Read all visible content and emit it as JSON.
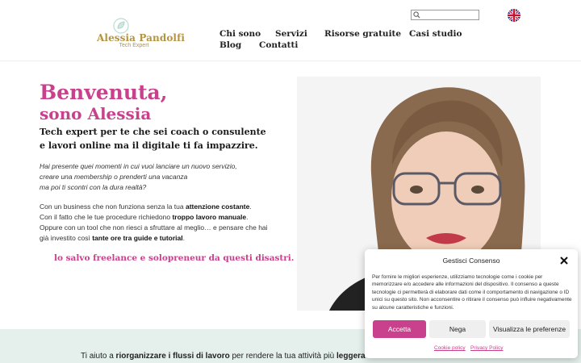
{
  "header": {
    "logo": {
      "name": "Alessia Pandolfi",
      "subtitle": "Tech Expert"
    },
    "nav": [
      {
        "label": "Chi sono"
      },
      {
        "label": "Servizi"
      },
      {
        "label": "Risorse gratuite"
      },
      {
        "label": "Casi studio"
      },
      {
        "label": "Blog"
      },
      {
        "label": "Contatti"
      }
    ],
    "search": {
      "placeholder": "",
      "value": ""
    },
    "language_icon": "uk-flag-icon"
  },
  "hero": {
    "title_line1": "Benvenuta,",
    "title_line2": "sono Alessia",
    "subtitle_line1": "Tech expert per te che sei coach o consulente",
    "subtitle_line2": "e lavori online ma il digitale ti fa impazzire.",
    "italic_lines": [
      "Hai presente quei momenti in cui vuoi lanciare un nuovo servizio,",
      "creare una membership o prenderti una vacanza",
      "ma poi ti scontri con la dura realtà?"
    ],
    "body": {
      "l1a": "Con un business che non funziona senza la tua ",
      "l1b": "attenzione costante",
      "l1c": ".",
      "l2a": "Con il fatto che le tue procedure richiedono ",
      "l2b": "troppo lavoro manuale",
      "l2c": ".",
      "l3": "Oppure con un tool che non riesci a sfruttare al meglio… e pensare che hai",
      "l4a": "già investito così ",
      "l4b": "tante ore tra guide e tutorial",
      "l4c": "."
    },
    "tagline": "lo salvo freelance e solopreneur da questi disastri."
  },
  "band": {
    "a": "Ti aiuto a ",
    "b": "riorganizzare i flussi di lavoro",
    "c": " per rendere la tua attività più ",
    "d": "leggera"
  },
  "cookie": {
    "title": "Gestisci Consenso",
    "text": "Per fornire le migliori esperienze, utilizziamo tecnologie come i cookie per memorizzare e/o accedere alle informazioni del dispositivo. Il consenso a queste tecnologie ci permetterà di elaborare dati come il comportamento di navigazione o ID unici su questo sito. Non acconsentire o ritirare il consenso può influire negativamente su alcune caratteristiche e funzioni.",
    "accept": "Accetta",
    "deny": "Nega",
    "preferences": "Visualizza le preferenze",
    "policy_link": "Cookie policy",
    "privacy_link": "Privacy Policy"
  },
  "colors": {
    "accent": "#c9418c",
    "gold": "#b5933f",
    "band": "#e5f0ec"
  }
}
